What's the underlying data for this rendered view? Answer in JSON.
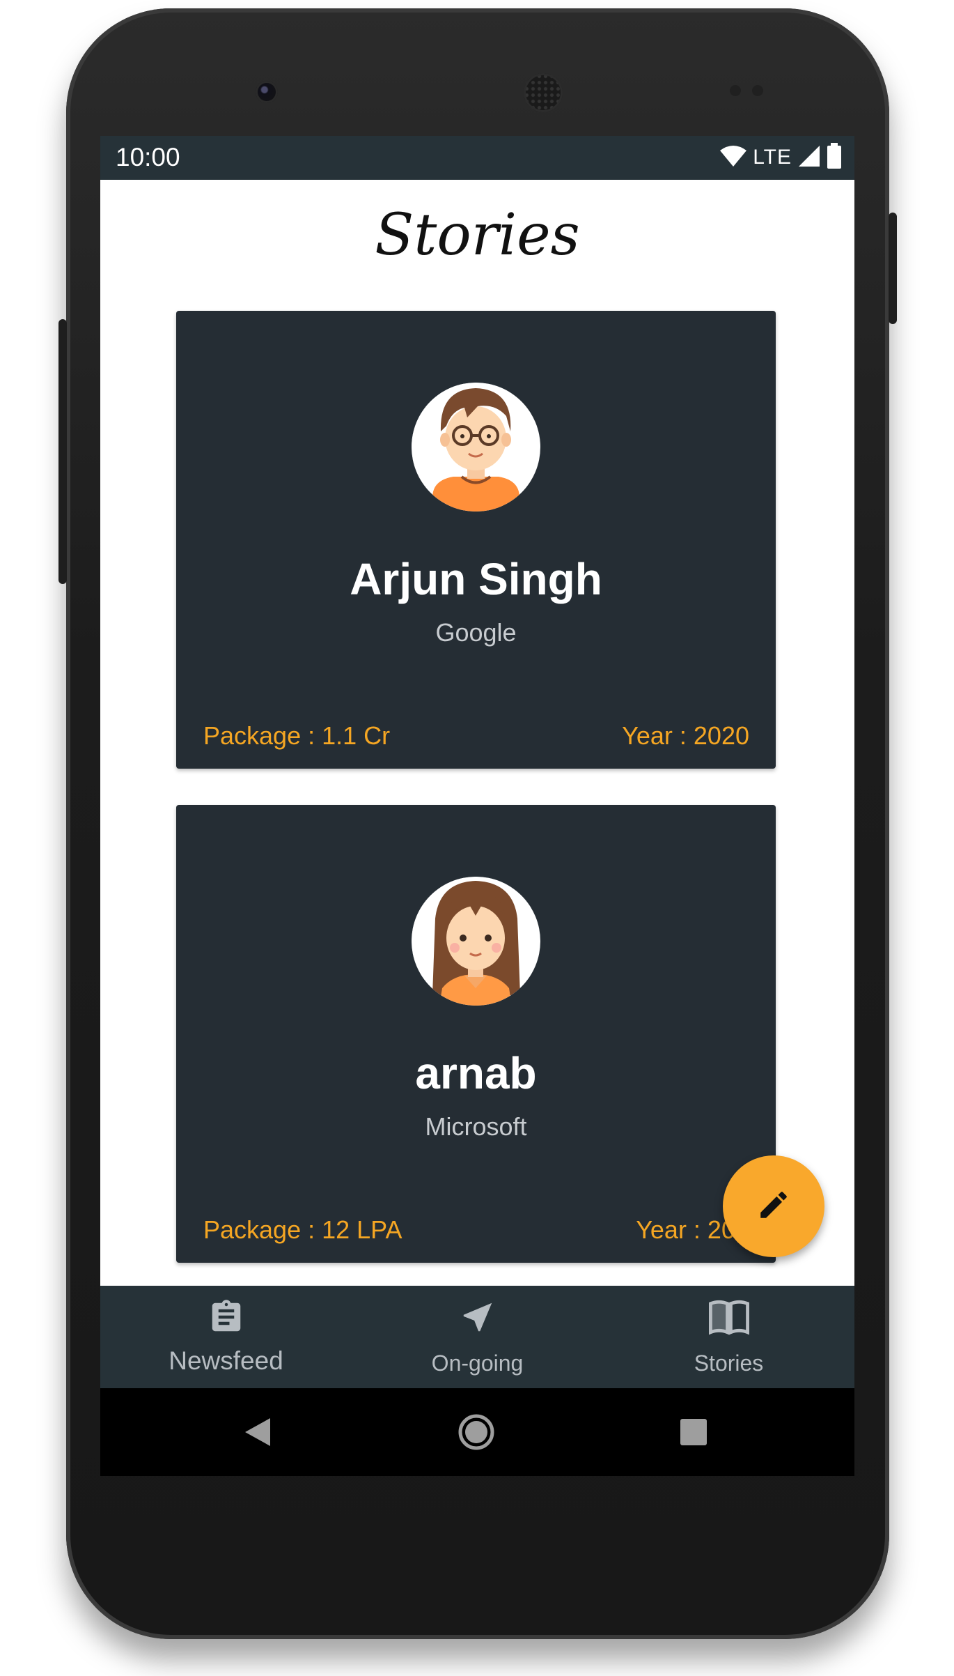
{
  "status_bar": {
    "time": "10:00",
    "network": "LTE"
  },
  "page": {
    "title": "Stories"
  },
  "stories": [
    {
      "name": "Arjun Singh",
      "company": "Google",
      "package": "Package : 1.1 Cr",
      "year": "Year : 2020",
      "avatar": "boy-avatar-icon"
    },
    {
      "name": "arnab",
      "company": "Microsoft",
      "package": "Package : 12 LPA",
      "year": "Year : 202",
      "avatar": "girl-avatar-icon"
    }
  ],
  "fab": {
    "icon": "pencil-icon"
  },
  "bottom_nav": {
    "items": [
      {
        "label": "Newsfeed",
        "icon": "clipboard-icon"
      },
      {
        "label": "On-going",
        "icon": "navigation-arrow-icon"
      },
      {
        "label": "Stories",
        "icon": "book-icon"
      }
    ]
  },
  "colors": {
    "status_bar": "#263238",
    "card": "#252d34",
    "accent": "#f5a623",
    "fab": "#f9a82c",
    "nav_text": "#b7bdc2"
  }
}
